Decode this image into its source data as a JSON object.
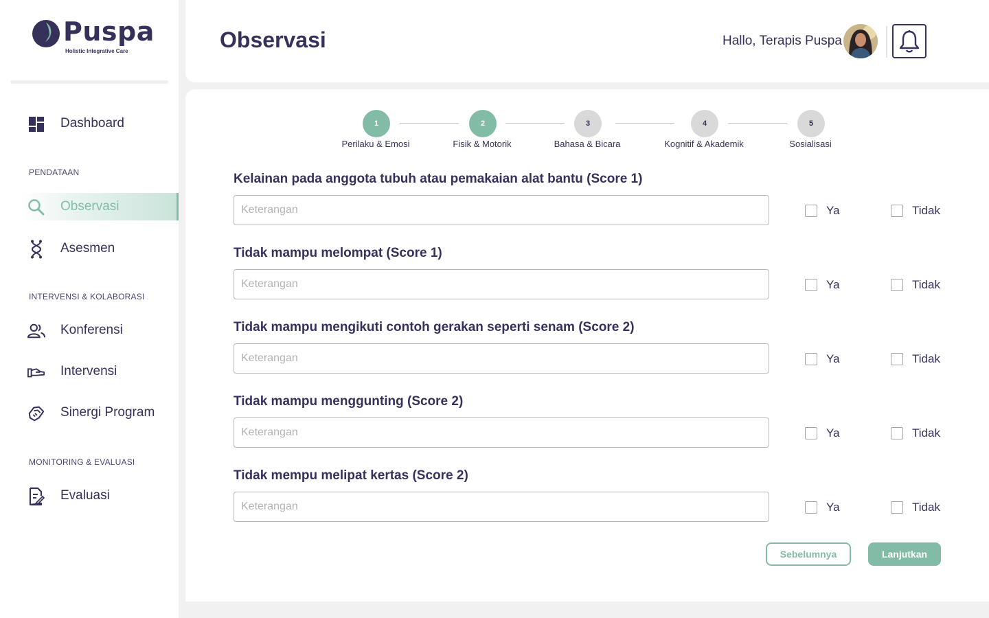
{
  "app": {
    "logo_name": "Puspa",
    "logo_tagline": "Holistic Integrative Care"
  },
  "colors": {
    "primary": "#36315b",
    "accent": "#82bca7",
    "inactive_step": "#d9d9d9"
  },
  "sidebar": {
    "items": [
      {
        "label": "Dashboard",
        "icon": "dashboard-icon"
      },
      {
        "label": "Observasi",
        "icon": "search-icon",
        "active": true
      },
      {
        "label": "Asesmen",
        "icon": "dna-icon"
      },
      {
        "label": "Konferensi",
        "icon": "people-icon"
      },
      {
        "label": "Intervensi",
        "icon": "hand-icon"
      },
      {
        "label": "Sinergi Program",
        "icon": "handshake-icon"
      },
      {
        "label": "Evaluasi",
        "icon": "document-edit-icon"
      }
    ],
    "sections": [
      "PENDATAAN",
      "INTERVENSI & KOLABORASI",
      "MONITORING & EVALUASI"
    ]
  },
  "header": {
    "title": "Observasi",
    "greeting": "Hallo, Terapis Puspa"
  },
  "stepper": {
    "current_step": 2,
    "steps": [
      {
        "number": "1",
        "label": "Perilaku & Emosi"
      },
      {
        "number": "2",
        "label": "Fisik & Motorik"
      },
      {
        "number": "3",
        "label": "Bahasa & Bicara"
      },
      {
        "number": "4",
        "label": "Kognitif & Akademik"
      },
      {
        "number": "5",
        "label": "Sosialisasi"
      }
    ]
  },
  "form": {
    "input_placeholder": "Keterangan",
    "yes_label": "Ya",
    "no_label": "Tidak",
    "questions": [
      {
        "title": "Kelainan pada anggota tubuh atau pemakaian alat bantu (Score 1)"
      },
      {
        "title": "Tidak mampu melompat (Score 1)"
      },
      {
        "title": "Tidak mampu mengikuti contoh gerakan seperti senam (Score 2)"
      },
      {
        "title": "Tidak mampu menggunting (Score 2)"
      },
      {
        "title": "Tidak mempu melipat kertas (Score 2)"
      }
    ]
  },
  "buttons": {
    "previous": "Sebelumnya",
    "next": "Lanjutkan"
  }
}
